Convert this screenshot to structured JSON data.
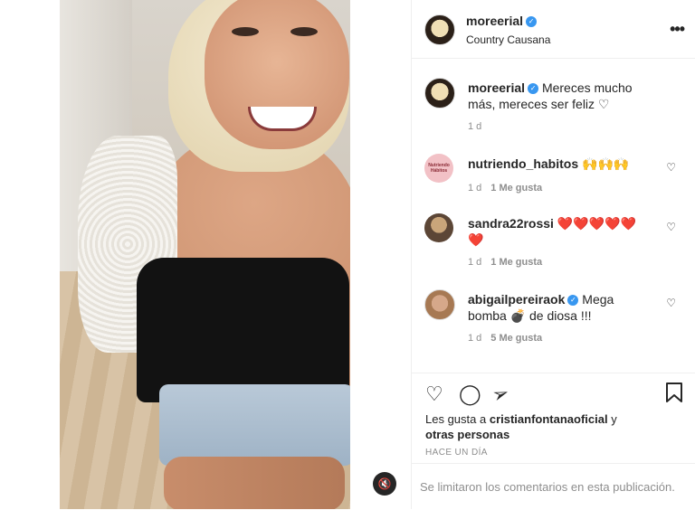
{
  "post": {
    "author": "moreerial",
    "location": "Country Causana",
    "more_icon": "ellipsis-icon"
  },
  "comments": [
    {
      "user": "moreerial",
      "text": "Mereces mucho más, mereces ser feliz ♡",
      "time": "1 d",
      "likes": ""
    },
    {
      "user": "nutriendo_habitos",
      "text": "🙌🙌🙌",
      "time": "1 d",
      "likes": "1 Me gusta",
      "avatar_text": "Nutriendo Hábitos"
    },
    {
      "user": "sandra22rossi",
      "text": "❤️❤️❤️❤️❤️❤️",
      "time": "1 d",
      "likes": "1 Me gusta"
    },
    {
      "user": "abigailpereiraok",
      "text": "Mega bomba 💣 de diosa !!!",
      "time": "1 d",
      "likes": "5 Me gusta"
    }
  ],
  "actions": {
    "likes_prefix": "Les gusta a",
    "likes_user": "cristianfontanaoficial",
    "likes_suffix": "y",
    "likes_others": "otras personas",
    "time_ago": "HACE UN DÍA"
  },
  "comments_disabled": "Se limitaron los comentarios en esta publicación.",
  "colors": {
    "verified": "#3897f0",
    "muted_text": "#8e8e8e",
    "border": "#efefef"
  }
}
